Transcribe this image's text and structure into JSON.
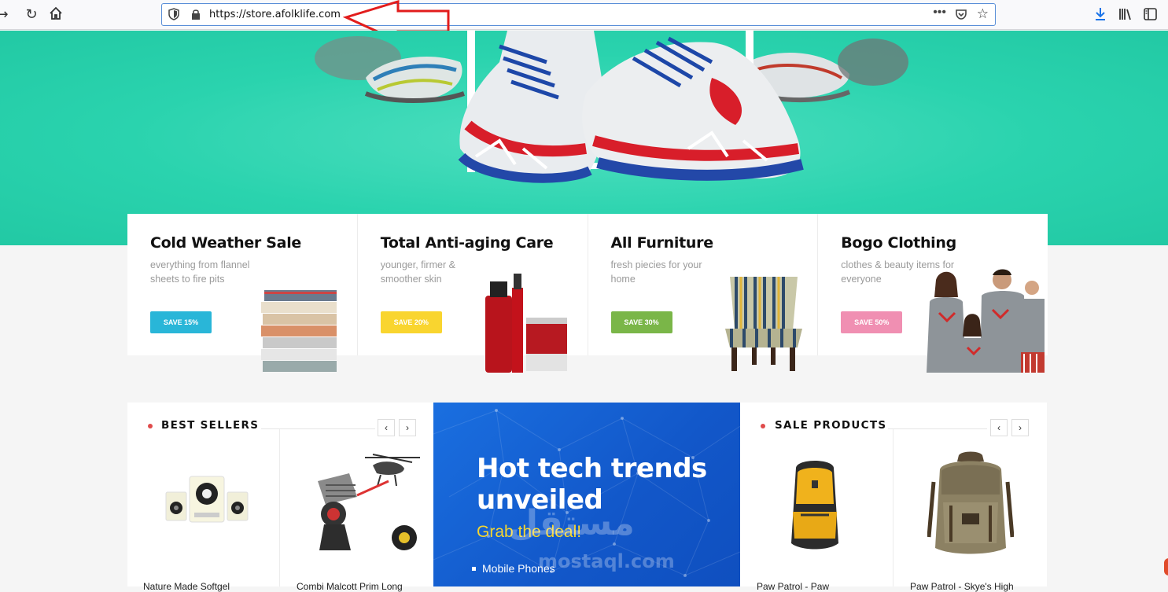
{
  "browser": {
    "url": "https://store.afolklife.com",
    "menu_dots": "•••"
  },
  "promos": [
    {
      "title": "Cold Weather Sale",
      "subtitle": "everything from flannel sheets to fire pits",
      "button": "SAVE 15%",
      "color": "#29b6d8"
    },
    {
      "title": "Total Anti-aging Care",
      "subtitle": "younger, firmer & smoother skin",
      "button": "SAVE 20%",
      "color": "#f9d52f"
    },
    {
      "title": "All Furniture",
      "subtitle": "fresh piecies for your home",
      "button": "SAVE 30%",
      "color": "#7ab648"
    },
    {
      "title": "Bogo Clothing",
      "subtitle": "clothes & beauty items for everyone",
      "button": "SAVE 50%",
      "color": "#f08fb2"
    }
  ],
  "best_sellers": {
    "heading": "BEST SELLERS",
    "prev": "‹",
    "next": "›",
    "products": [
      {
        "name": "Nature Made Softgel"
      },
      {
        "name": "Combi Malcott Prim Long"
      }
    ]
  },
  "tech_banner": {
    "title_line1": "Hot tech trends",
    "title_line2": "unveiled",
    "subtitle": "Grab the deal!",
    "item": "Mobile Phones"
  },
  "sale_products": {
    "heading": "SALE PRODUCTS",
    "prev": "‹",
    "next": "›",
    "products": [
      {
        "name": "Paw Patrol - Paw"
      },
      {
        "name": "Paw Patrol - Skye's High"
      }
    ]
  },
  "watermark": {
    "arabic": "مستقل",
    "latin": "mostaql.com"
  }
}
